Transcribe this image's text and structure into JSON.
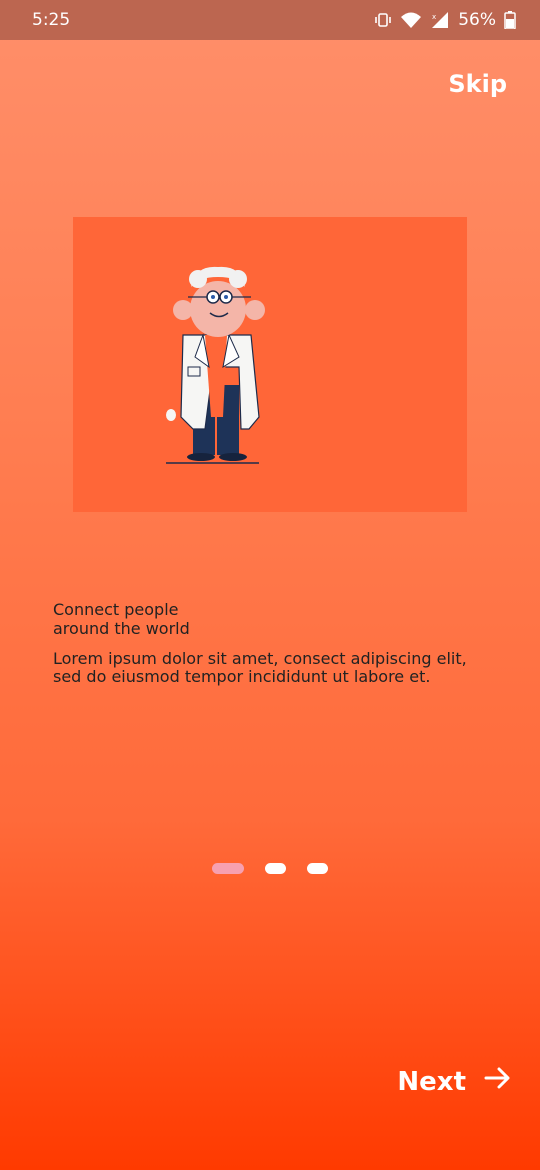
{
  "statusbar": {
    "time": "5:25",
    "battery": "56%",
    "icons": [
      "vibrate-icon",
      "wifi-icon",
      "signal-icon",
      "battery-icon"
    ]
  },
  "onboarding": {
    "skip_label": "Skip",
    "title": "Connect people around the world",
    "description": "Lorem ipsum dolor sit amet, consect adipiscing elit, sed do eiusmod tempor incididunt ut labore et.",
    "pages_total": 3,
    "active_page": 1,
    "next_label": "Next"
  },
  "colors": {
    "background_top": "#FF8F6A",
    "background_bottom": "#FF3A00",
    "illustration_bg": "#FF6638",
    "active_dot": "#F7A0B0",
    "statusbar": "#BC6650"
  },
  "illustration": {
    "icon": "scientist-illustration"
  }
}
